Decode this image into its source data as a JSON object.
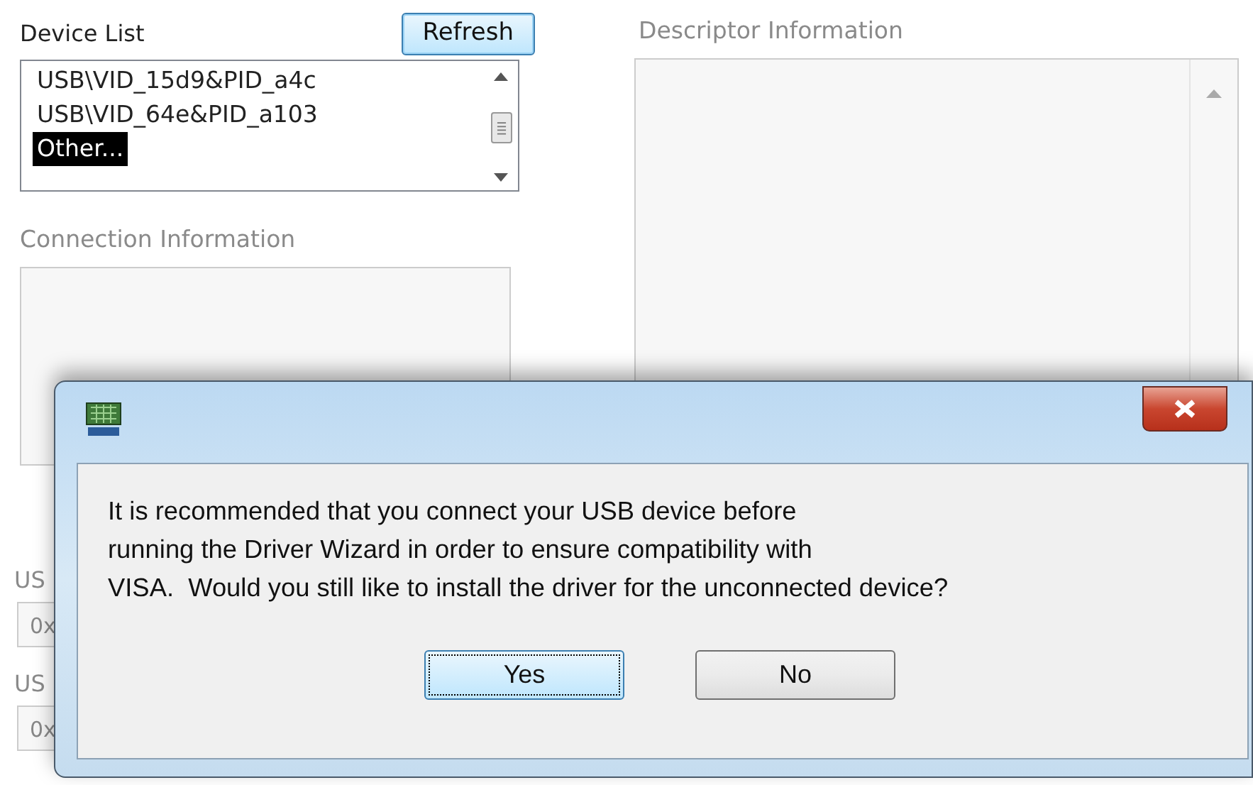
{
  "device_list": {
    "label": "Device List",
    "refresh_button": "Refresh",
    "items": [
      {
        "text": "USB\\VID_15d9&PID_a4c",
        "selected": false
      },
      {
        "text": "USB\\VID_64e&PID_a103",
        "selected": false
      },
      {
        "text": "Other...",
        "selected": true
      }
    ]
  },
  "connection_information": {
    "label": "Connection Information"
  },
  "descriptor_information": {
    "label": "Descriptor Information"
  },
  "partial_fields": [
    {
      "label": "US",
      "value": "0x"
    },
    {
      "label": "US",
      "value": "0x"
    }
  ],
  "dialog": {
    "message": "It is recommended that you connect your USB device before\nrunning the Driver Wizard in order to ensure compatibility with\nVISA.  Would you still like to install the driver for the unconnected device?",
    "buttons": [
      {
        "label": "Yes",
        "focused": true
      },
      {
        "label": "No",
        "focused": false
      }
    ]
  }
}
